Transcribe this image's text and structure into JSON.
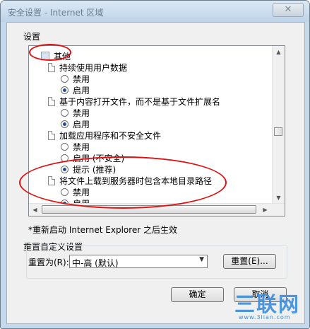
{
  "window": {
    "title": "安全设置 - Internet 区域",
    "close_glyph": "✕"
  },
  "settings": {
    "group_label": "设置",
    "category": "其他",
    "items": [
      {
        "label": "持续使用用户数据",
        "options": [
          {
            "label": "禁用",
            "selected": false
          },
          {
            "label": "启用",
            "selected": true
          }
        ]
      },
      {
        "label": "基于内容打开文件，而不是基于文件扩展名",
        "options": [
          {
            "label": "禁用",
            "selected": false
          },
          {
            "label": "启用",
            "selected": true
          }
        ]
      },
      {
        "label": "加载应用程序和不安全文件",
        "options": [
          {
            "label": "禁用",
            "selected": false
          },
          {
            "label": "启用 (不安全)",
            "selected": false
          },
          {
            "label": "提示 (推荐)",
            "selected": true
          }
        ]
      },
      {
        "label": "将文件上载到服务器时包含本地目录路径",
        "options": [
          {
            "label": "禁用",
            "selected": false
          },
          {
            "label": "启用",
            "selected": true
          }
        ]
      }
    ],
    "scroll_up_glyph": "▲",
    "scroll_down_glyph": "▼",
    "scroll_left_glyph": "◀",
    "scroll_right_glyph": "▶"
  },
  "restart_note": "*重新启动 Internet Explorer 之后生效",
  "reset": {
    "group_label": "重置自定义设置",
    "reset_to_label": "重置为(R):",
    "selected_level": "中-高 (默认)",
    "dropdown_glyph": "▼",
    "reset_button": "重置(E)..."
  },
  "footer": {
    "ok_button": "确定",
    "cancel_button": "取消"
  },
  "watermark": {
    "text": "三联网",
    "sub": "www.3lian.com"
  },
  "colors": {
    "annotation": "#e01010",
    "radio_dot": "#1a4fa0"
  }
}
